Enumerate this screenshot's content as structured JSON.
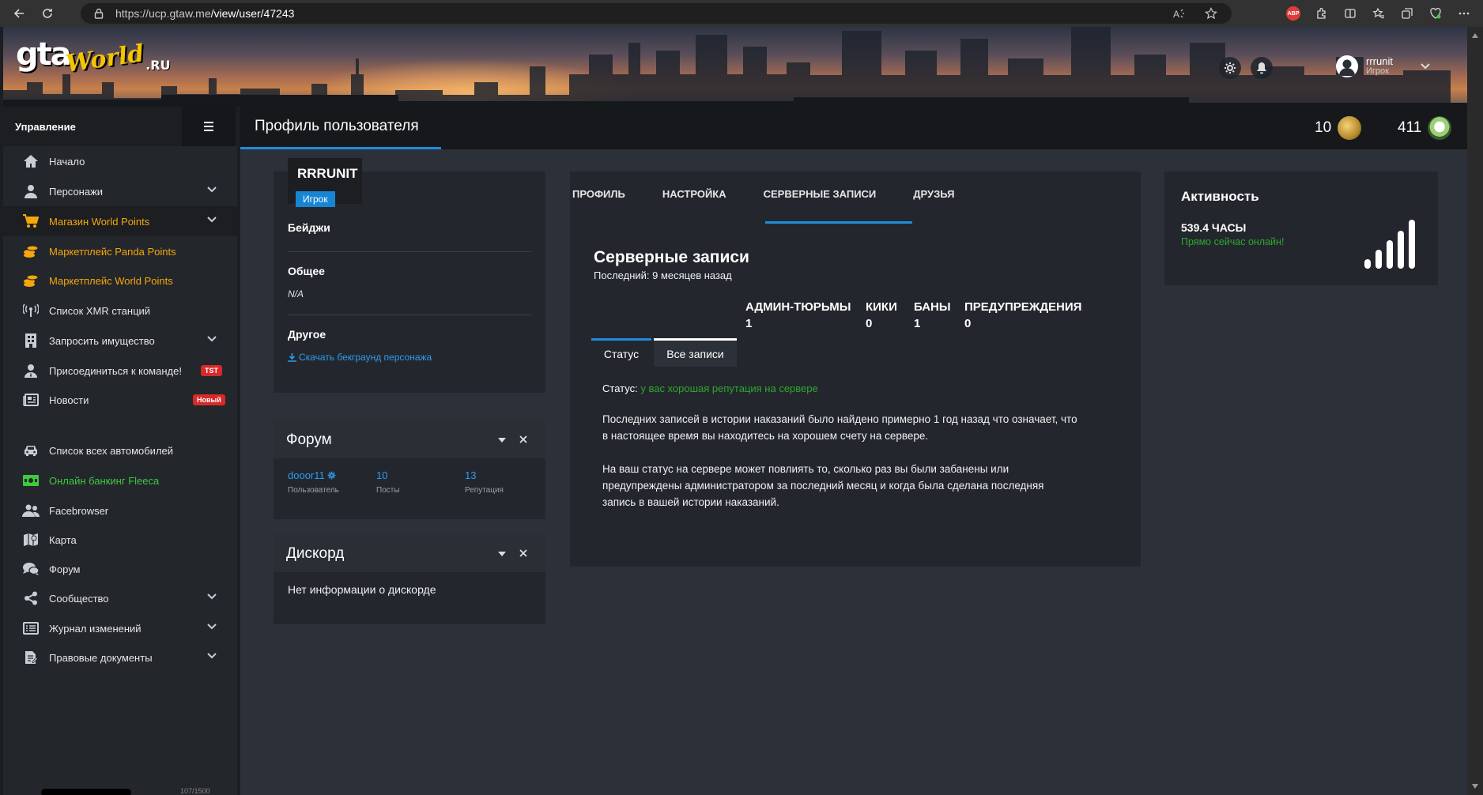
{
  "browser": {
    "url_host": "https://ucp.gtaw.me",
    "url_path": "/view/user/47243",
    "adblock_label": "ABP"
  },
  "brand": {
    "logo_gta": "gta",
    "logo_world": "World",
    "logo_ru": ".RU"
  },
  "header_user": {
    "name": "rrrunit",
    "role": "Игрок"
  },
  "sidebar": {
    "title": "Управление",
    "items": [
      {
        "label": "Начало",
        "icon": "home-icon",
        "style": "normal"
      },
      {
        "label": "Персонажи",
        "icon": "user-icon",
        "style": "normal",
        "expand": true
      },
      {
        "label": "Магазин World Points",
        "icon": "cart-icon",
        "style": "gold",
        "expand": true
      },
      {
        "label": "Маркетплейс Panda Points",
        "icon": "coins-icon",
        "style": "gold"
      },
      {
        "label": "Маркетплейс World Points",
        "icon": "coins-icon",
        "style": "gold"
      },
      {
        "label": "Список XMR станций",
        "icon": "broadcast-icon",
        "style": "normal"
      },
      {
        "label": "Запросить имущество",
        "icon": "building-icon",
        "style": "normal",
        "expand": true
      },
      {
        "label": "Присоединиться к команде!",
        "icon": "user-tie-icon",
        "style": "normal",
        "badge": "TST"
      },
      {
        "label": "Новости",
        "icon": "newspaper-icon",
        "style": "normal",
        "badge": "Новый"
      },
      {
        "label": "Список всех автомобилей",
        "icon": "car-icon",
        "style": "normal"
      },
      {
        "label": "Онлайн банкинг Fleeca",
        "icon": "money-icon",
        "style": "green"
      },
      {
        "label": "Facebrowser",
        "icon": "users-icon",
        "style": "normal"
      },
      {
        "label": "Карта",
        "icon": "map-icon",
        "style": "normal"
      },
      {
        "label": "Форум",
        "icon": "comments-icon",
        "style": "normal"
      },
      {
        "label": "Сообщество",
        "icon": "share-icon",
        "style": "normal",
        "expand": true
      },
      {
        "label": "Журнал изменений",
        "icon": "list-icon",
        "style": "normal",
        "expand": true
      },
      {
        "label": "Правовые документы",
        "icon": "document-icon",
        "style": "normal",
        "expand": true
      }
    ],
    "footer_progress": "107/1500"
  },
  "topbar": {
    "title": "Профиль пользователя",
    "points_a": "10",
    "points_b": "411"
  },
  "profile": {
    "username": "RRRUNIT",
    "role": "Игрок",
    "badges_heading": "Бейджи",
    "general_heading": "Общее",
    "general_value": "N/A",
    "other_heading": "Другое",
    "download_link": "Скачать бекграунд персонажа"
  },
  "forum_panel": {
    "title": "Форум",
    "user": "dooor11",
    "user_label": "Пользователь",
    "posts": "10",
    "posts_label": "Посты",
    "reputation": "13",
    "reputation_label": "Репутация"
  },
  "discord_panel": {
    "title": "Дискорд",
    "text": "Нет информации о дискорде"
  },
  "tabs": [
    {
      "label": "ПРОФИЛЬ"
    },
    {
      "label": "НАСТРОЙКА"
    },
    {
      "label": "СЕРВЕРНЫЕ ЗАПИСИ"
    },
    {
      "label": "ДРУЗЬЯ"
    }
  ],
  "records": {
    "title": "Серверные записи",
    "last": "Последний: 9 месяцев назад",
    "stats": [
      {
        "label": "АДМИН-ТЮРЬМЫ",
        "value": "1"
      },
      {
        "label": "КИКИ",
        "value": "0"
      },
      {
        "label": "БАНЫ",
        "value": "1"
      },
      {
        "label": "ПРЕДУПРЕЖДЕНИЯ",
        "value": "0"
      }
    ],
    "subtabs": [
      "Статус",
      "Все записи"
    ],
    "status_label": "Статус:",
    "status_value": "у вас хорошая репутация на сервере",
    "para1_line1": "Последних записей в истории наказаний было найдено примерно 1 год назад что означает, что",
    "para1_line2": "в настоящее время вы находитесь на хорошем счету на сервере.",
    "para2_line1": "На ваш статус на сервере может повлиять то, сколько раз вы были забанены или",
    "para2_line2": "предупреждены администратором за последний месяц и когда была сделана последняя",
    "para2_line3": "запись в вашей истории наказаний."
  },
  "activity": {
    "title": "Активность",
    "hours": "539.4 ЧАСЫ",
    "online": "Прямо сейчас онлайн!"
  },
  "colors": {
    "accent": "#1f8ce0",
    "gold": "#f5a70c",
    "green": "#3fc93f",
    "badge_red": "#d62a2a"
  }
}
